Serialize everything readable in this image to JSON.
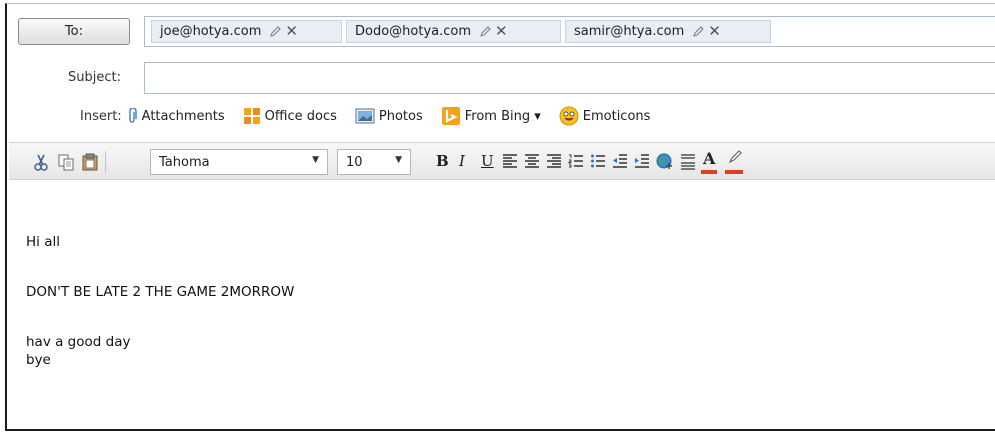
{
  "header": {
    "to_button_label": "To:",
    "recipients": [
      {
        "email": "joe@hotya.com"
      },
      {
        "email": "Dodo@hotya.com"
      },
      {
        "email": "samir@htya.com"
      }
    ],
    "subject_label": "Subject:",
    "subject_value": ""
  },
  "insert": {
    "label": "Insert:",
    "items": [
      {
        "label": "Attachments",
        "icon": "paperclip-icon"
      },
      {
        "label": "Office docs",
        "icon": "office-docs-icon"
      },
      {
        "label": "Photos",
        "icon": "photos-icon"
      },
      {
        "label": "From Bing ▾",
        "icon": "bing-icon"
      },
      {
        "label": "Emoticons",
        "icon": "emoticon-icon"
      }
    ]
  },
  "toolbar": {
    "font_family": "Tahoma",
    "font_size": "10",
    "buttons": [
      "cut",
      "copy",
      "paste",
      "bold",
      "italic",
      "underline",
      "align-left",
      "align-center",
      "align-right",
      "numbered-list",
      "bulleted-list",
      "decrease-indent",
      "increase-indent",
      "insert-link",
      "paragraph-format",
      "font-color",
      "highlight"
    ],
    "bold_label": "B",
    "italic_label": "I",
    "underline_label": "U",
    "font_color_label": "A"
  },
  "body": {
    "line1": "Hi all",
    "line2": "DON'T BE LATE 2 THE GAME 2MORROW",
    "line3": "hav a good day",
    "line4": "bye"
  },
  "colors": {
    "accent_border": "#a9bcd0",
    "chip_bg": "#e9eef5",
    "font_color_underline": "#e03c28",
    "highlight_underline": "#e03c28"
  }
}
